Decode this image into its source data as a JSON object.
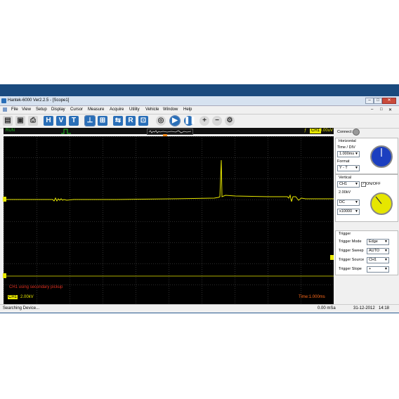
{
  "window": {
    "title": "Hantek-6000 Ver2.2.5 - [Scope1]",
    "controls": [
      "–",
      "□",
      "✕"
    ],
    "inner_controls": [
      "–",
      "□",
      "✕"
    ]
  },
  "menu": [
    "File",
    "View",
    "Setup",
    "Display",
    "Cursor",
    "Measure",
    "Acquire",
    "Utility",
    "Vehicle",
    "Window",
    "Help"
  ],
  "toolbar": {
    "buttons": [
      "H",
      "V",
      "T",
      "R"
    ]
  },
  "status_top": {
    "run": "RUN",
    "channel": "CH1",
    "value": "0.00uV"
  },
  "screen": {
    "note": "CH1 using secondary pickup",
    "ch_badge": "CH1",
    "volts": "2.00kV",
    "time": "Time:1.000ms",
    "colors": {
      "trace": "#e6e600",
      "grid": "#3a3a3a",
      "note": "#e03020",
      "time": "#ff6a1a"
    }
  },
  "right_panel": {
    "connect": "Connect:",
    "horizontal": {
      "title": "Horizontal",
      "time_div_label": "Time / DIV",
      "time_div": "1.000ms",
      "format_label": "Format",
      "format": "Y - T"
    },
    "vertical": {
      "title": "Vertical",
      "channel": "CH1",
      "onoff": "ON/OFF",
      "volts": "2.00kV",
      "coupling": "DC",
      "probe": "x10000"
    },
    "trigger": {
      "title": "Trigger",
      "rows": [
        {
          "label": "Trigger Mode",
          "value": "Edge"
        },
        {
          "label": "Trigger Sweep",
          "value": "AUTO"
        },
        {
          "label": "Trigger Source",
          "value": "CH1"
        },
        {
          "label": "Trigger Slope",
          "value": "+"
        }
      ]
    }
  },
  "bottom_status": {
    "left": "Searching Device...",
    "samples": "0.00 mSa",
    "date": "31-12-2012",
    "time": "14:18"
  }
}
